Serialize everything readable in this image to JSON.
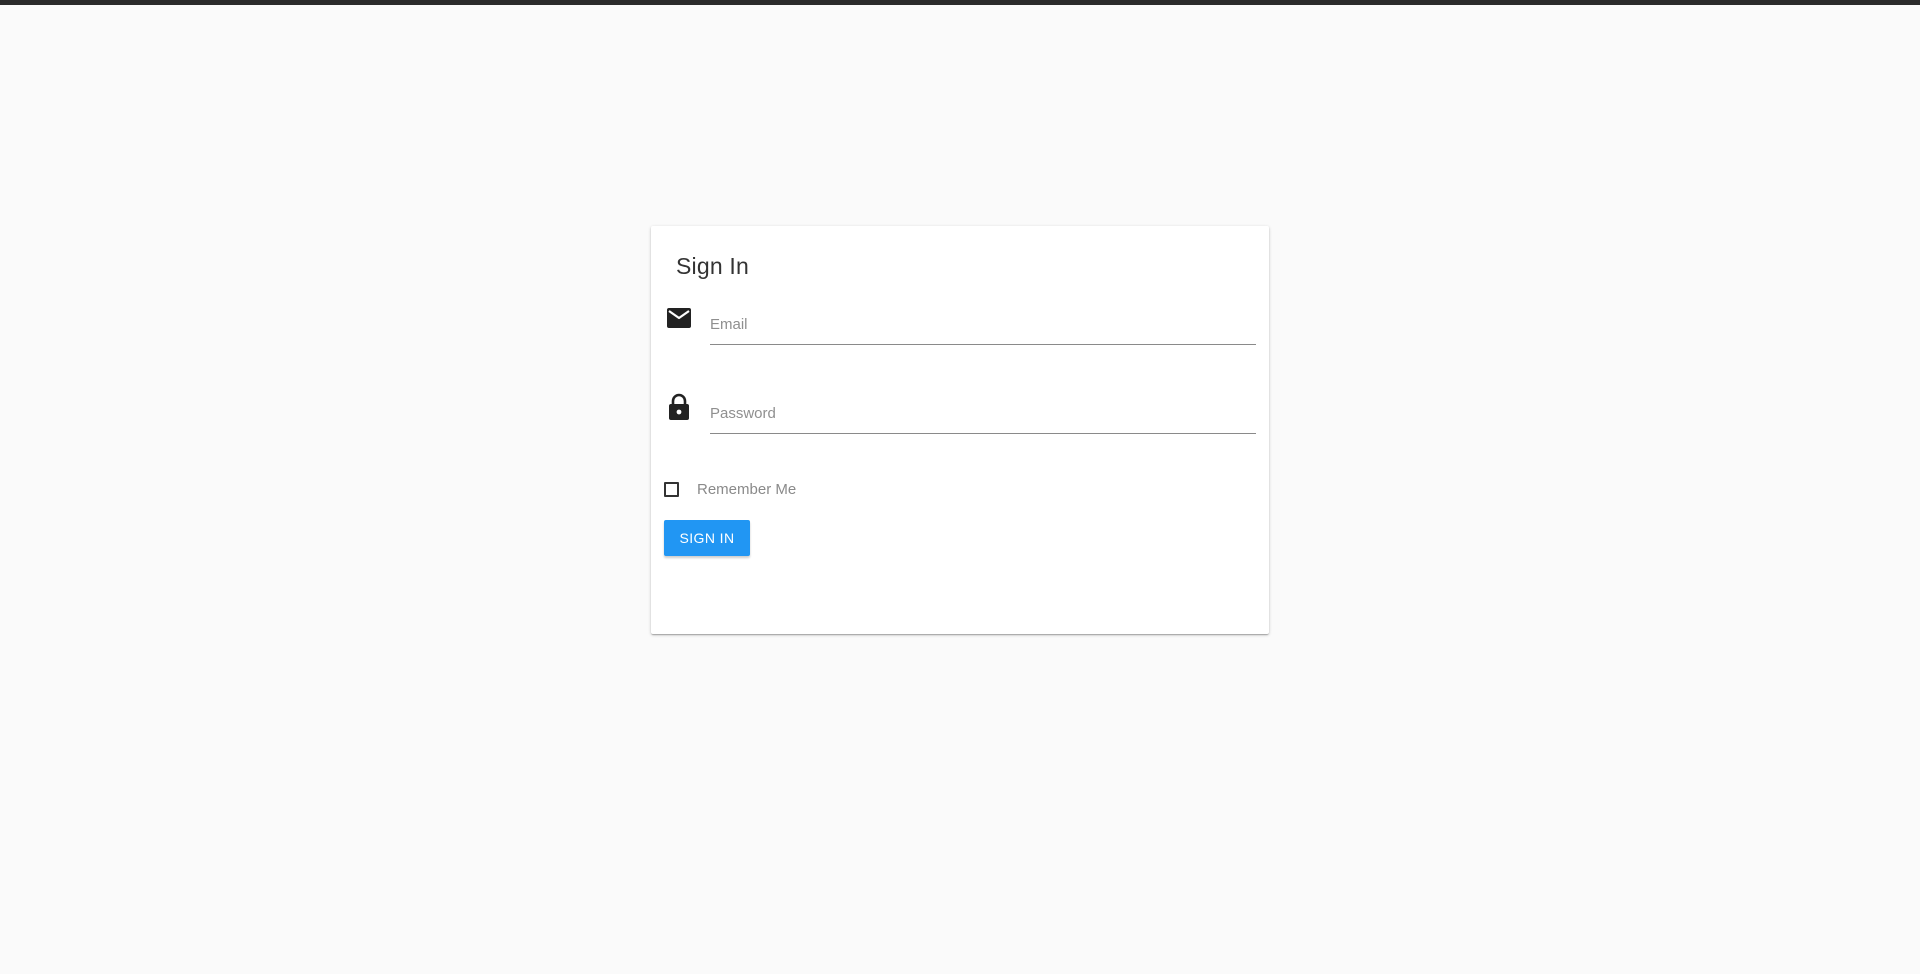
{
  "form": {
    "title": "Sign In",
    "email": {
      "placeholder": "Email",
      "value": "",
      "icon": "mail-icon"
    },
    "password": {
      "placeholder": "Password",
      "value": "",
      "icon": "lock-icon"
    },
    "remember": {
      "label": "Remember Me",
      "checked": false
    },
    "submit_label": "SIGN IN"
  },
  "colors": {
    "background": "#fafafa",
    "top_bar": "#2b2b2b",
    "card": "#ffffff",
    "primary": "#2196f3",
    "icon": "#222222"
  }
}
